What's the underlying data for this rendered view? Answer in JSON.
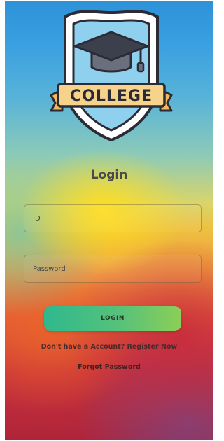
{
  "logo": {
    "text": "COLLEGE",
    "icon": "graduation-cap-icon"
  },
  "title": "Login",
  "id_field": {
    "placeholder": "ID",
    "value": ""
  },
  "password_field": {
    "placeholder": "Password",
    "value": ""
  },
  "login_button": "LOGIN",
  "register": {
    "prompt": "Don't have a Account?",
    "link": "Register Now"
  },
  "forgot_password": "Forgot Password",
  "colors": {
    "button_start": "#2fb88e",
    "button_end": "#8cce56",
    "title": "#4a4a4a",
    "logo_outline": "#2b2b35",
    "logo_banner": "#f6d28a",
    "logo_shield": "#8fd0ee"
  }
}
